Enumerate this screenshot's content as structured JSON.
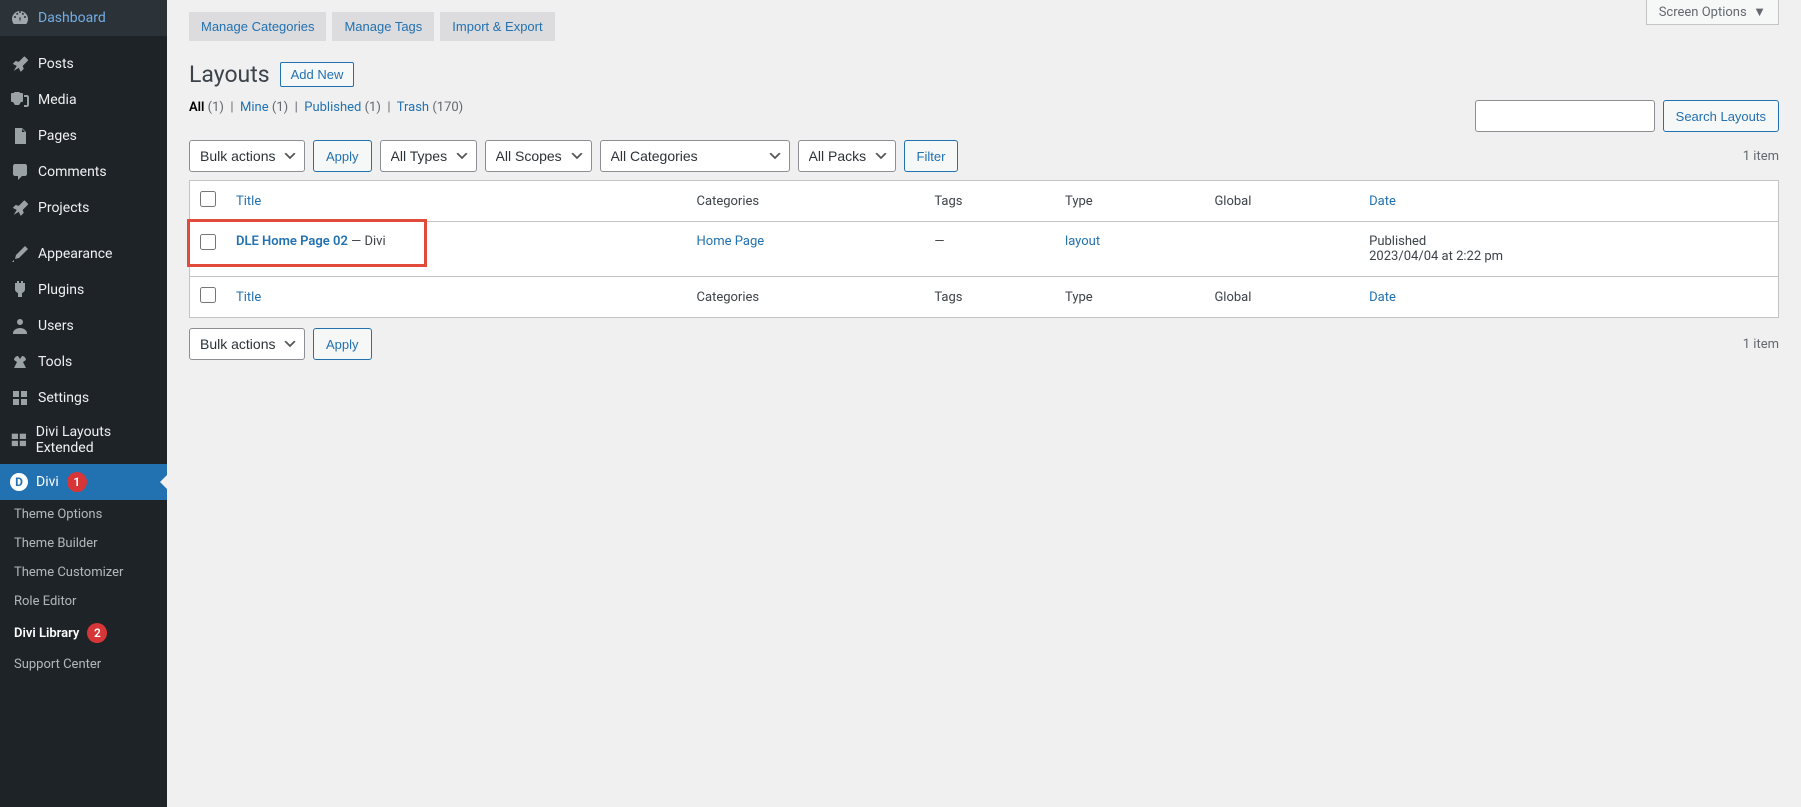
{
  "sidebar": {
    "items": [
      {
        "label": "Dashboard"
      },
      {
        "label": "Posts"
      },
      {
        "label": "Media"
      },
      {
        "label": "Pages"
      },
      {
        "label": "Comments"
      },
      {
        "label": "Projects"
      },
      {
        "label": "Appearance"
      },
      {
        "label": "Plugins"
      },
      {
        "label": "Users"
      },
      {
        "label": "Tools"
      },
      {
        "label": "Settings"
      },
      {
        "label": "Divi Layouts Extended"
      },
      {
        "label": "Divi",
        "badge": "1"
      }
    ],
    "submenu": [
      {
        "label": "Theme Options"
      },
      {
        "label": "Theme Builder"
      },
      {
        "label": "Theme Customizer"
      },
      {
        "label": "Role Editor"
      },
      {
        "label": "Divi Library",
        "badge": "2"
      },
      {
        "label": "Support Center"
      }
    ]
  },
  "topTabs": {
    "manage_categories": "Manage Categories",
    "manage_tags": "Manage Tags",
    "import_export": "Import & Export"
  },
  "screenOptions": "Screen Options",
  "page": {
    "title": "Layouts",
    "add_new": "Add New"
  },
  "filters_links": {
    "all": "All",
    "all_count": "(1)",
    "mine": "Mine",
    "mine_count": "(1)",
    "published": "Published",
    "published_count": "(1)",
    "trash": "Trash",
    "trash_count": "(170)"
  },
  "search": {
    "button": "Search Layouts"
  },
  "bulk": {
    "actions": "Bulk actions",
    "apply": "Apply"
  },
  "filterSelects": {
    "types": "All Types",
    "scopes": "All Scopes",
    "categories": "All Categories",
    "packs": "All Packs",
    "filter": "Filter"
  },
  "itemCount": "1 item",
  "table": {
    "headers": {
      "title": "Title",
      "categories": "Categories",
      "tags": "Tags",
      "type": "Type",
      "global": "Global",
      "date": "Date"
    },
    "rows": [
      {
        "title": "DLE Home Page 02",
        "suffix": " — Divi",
        "category": "Home Page",
        "tags": "—",
        "type": "layout",
        "global": "",
        "date_status": "Published",
        "date": "2023/04/04 at 2:22 pm"
      }
    ]
  }
}
